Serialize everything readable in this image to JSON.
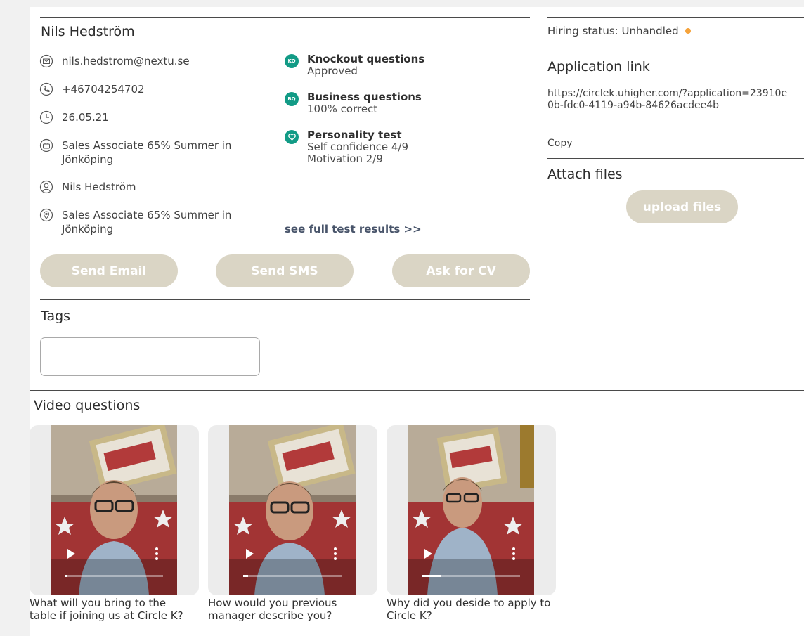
{
  "candidate": {
    "name": "Nils Hedström",
    "email": "nils.hedstrom@nextu.se",
    "phone": "+46704254702",
    "date": "26.05.21",
    "job": "Sales Associate 65% Summer in Jönköping",
    "recruiter": "Nils Hedström",
    "location": "Sales Associate 65% Summer in Jönköping"
  },
  "tests": [
    {
      "badge": "KO",
      "title": "Knockout questions",
      "lines": [
        "Approved"
      ]
    },
    {
      "badge": "BQ",
      "title": "Business questions",
      "lines": [
        "100% correct"
      ]
    },
    {
      "badge": "",
      "title": "Personality test",
      "lines": [
        "Self confidence 4/9",
        "Motivation 2/9"
      ]
    }
  ],
  "see_full_results": "see full test results >>",
  "actions": {
    "send_email": "Send Email",
    "send_sms": "Send SMS",
    "ask_cv": "Ask for CV"
  },
  "tags": {
    "label": "Tags",
    "value": ""
  },
  "sidebar": {
    "hiring_status": "Hiring status: Unhandled",
    "status_color": "#f5a33b",
    "application_link_title": "Application link",
    "application_url": "https://circlek.uhigher.com/?application=23910e0b-fdc0-4119-a94b-84626acdee4b",
    "copy": "Copy",
    "attach_files_title": "Attach files",
    "upload_files": "upload files"
  },
  "video_questions": {
    "title": "Video questions",
    "items": [
      {
        "caption": "What will you bring to the table if joining us at Circle K?",
        "progress": 0.03
      },
      {
        "caption": "How would you previous manager describe you?",
        "progress": 0.05
      },
      {
        "caption": "Why did you deside to apply to Circle K?",
        "progress": 0.2
      }
    ]
  },
  "colors": {
    "accent": "#129b86",
    "button_bg": "#dad5c5",
    "link": "#48546a"
  }
}
